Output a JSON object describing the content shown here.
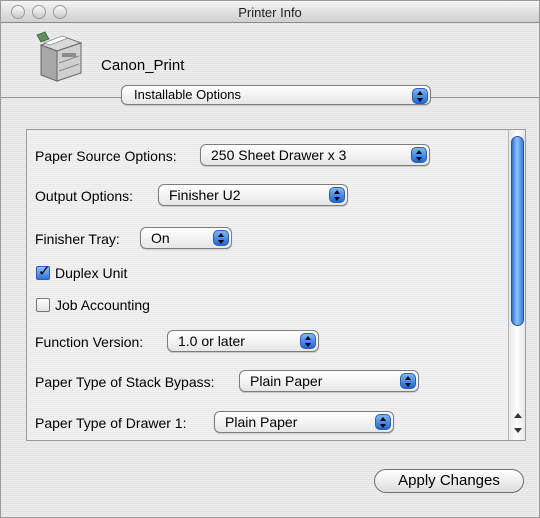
{
  "window": {
    "title": "Printer Info"
  },
  "printer": {
    "name": "Canon_Print",
    "icon": "printer-icon"
  },
  "section_selector": {
    "selected": "Installable Options"
  },
  "options": {
    "paper_source": {
      "label": "Paper Source Options:",
      "value": "250 Sheet Drawer x 3"
    },
    "output": {
      "label": "Output Options:",
      "value": "Finisher U2"
    },
    "finisher_tray": {
      "label": "Finisher Tray:",
      "value": "On"
    },
    "duplex_unit": {
      "label": "Duplex Unit",
      "checked": true
    },
    "job_accounting": {
      "label": "Job Accounting",
      "checked": false
    },
    "function_version": {
      "label": "Function Version:",
      "value": "1.0 or later"
    },
    "stack_bypass": {
      "label": "Paper Type of Stack Bypass:",
      "value": "Plain Paper"
    },
    "drawer1": {
      "label": "Paper Type of Drawer 1:",
      "value": "Plain Paper"
    }
  },
  "buttons": {
    "apply": "Apply Changes"
  },
  "colors": {
    "accent": "#2d73dd",
    "window_bg": "#e8e8e8"
  }
}
